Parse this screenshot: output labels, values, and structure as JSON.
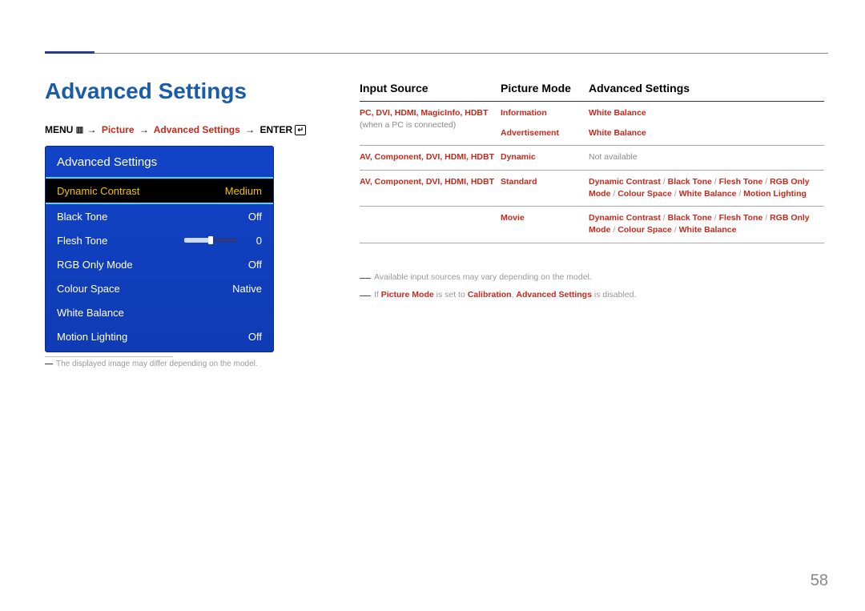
{
  "heading": "Advanced Settings",
  "breadcrumb": {
    "menu": "MENU",
    "arrow": "→",
    "seg1": "Picture",
    "seg2": "Advanced Settings",
    "enter": "ENTER"
  },
  "osd": {
    "title": "Advanced Settings",
    "rows": [
      {
        "label": "Dynamic Contrast",
        "value": "Medium",
        "selected": true,
        "slider": false
      },
      {
        "label": "Black Tone",
        "value": "Off",
        "selected": false,
        "slider": false
      },
      {
        "label": "Flesh Tone",
        "value": "0",
        "selected": false,
        "slider": true
      },
      {
        "label": "RGB Only Mode",
        "value": "Off",
        "selected": false,
        "slider": false
      },
      {
        "label": "Colour Space",
        "value": "Native",
        "selected": false,
        "slider": false
      },
      {
        "label": "White Balance",
        "value": "",
        "selected": false,
        "slider": false
      },
      {
        "label": "Motion Lighting",
        "value": "Off",
        "selected": false,
        "slider": false
      }
    ]
  },
  "osd_footnote": "The displayed image may differ depending on the model.",
  "table": {
    "headers": {
      "c1": "Input Source",
      "c2": "Picture Mode",
      "c3": "Advanced Settings"
    },
    "row1": {
      "source_red": "PC, DVI, HDMI, MagicInfo, HDBT",
      "source_grey": " (when a PC is connected)",
      "mode1": "Information",
      "mode2": "Advertisement",
      "adv1": "White Balance",
      "adv2": "White Balance"
    },
    "row2": {
      "sources": "AV, Component, DVI, HDMI, HDBT",
      "mode": "Dynamic",
      "adv": "Not available"
    },
    "row3": {
      "sources": "AV, Component, DVI, HDMI, HDBT",
      "mode": "Standard",
      "adv_parts": [
        "Dynamic Contrast",
        "Black Tone",
        "Flesh Tone",
        "RGB Only Mode",
        "Colour Space",
        "White Balance",
        "Motion Lighting"
      ]
    },
    "row4": {
      "mode": "Movie",
      "adv_parts": [
        "Dynamic Contrast",
        "Black Tone",
        "Flesh Tone",
        "RGB Only Mode",
        "Colour Space",
        "White Balance"
      ]
    }
  },
  "notes": {
    "n1": "Available input sources may vary depending on the model.",
    "n2_pre": "If ",
    "n2_b1": "Picture Mode",
    "n2_mid": " is set to ",
    "n2_b2": "Calibration",
    "n2_sep": ", ",
    "n2_b3": "Advanced Settings",
    "n2_post": " is disabled."
  },
  "page_number": "58"
}
